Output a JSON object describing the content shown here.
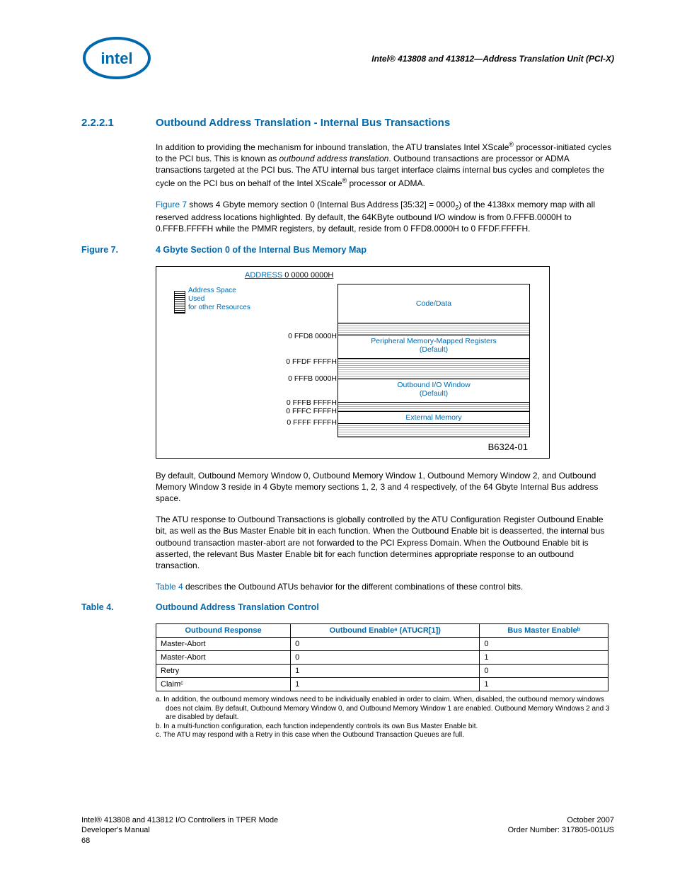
{
  "header": {
    "title_html": "Intel® 413808 and 413812—Address Translation Unit (PCI-X)"
  },
  "section": {
    "num": "2.2.2.1",
    "title": "Outbound Address Translation - Internal Bus Transactions"
  },
  "para1": "In addition to providing the mechanism for inbound translation, the ATU translates Intel XScale® processor-initiated cycles to the PCI bus. This is known as outbound address translation. Outbound transactions are processor or ADMA transactions targeted at the PCI bus. The ATU internal bus target interface claims internal bus cycles and completes the cycle on the PCI bus on behalf of the Intel XScale® processor or ADMA.",
  "para2_pre": "Figure 7",
  "para2_post": " shows 4 Gbyte memory section 0 (Internal Bus Address [35:32] = 0000",
  "para2_sub": "2",
  "para2_tail": ") of the 4138xx memory map with all reserved address locations highlighted. By default, the 64KByte outbound I/O window is from 0.FFFB.0000H to 0.FFFB.FFFFH while the PMMR registers, by default, reside from 0 FFD8.0000H to 0 FFDF.FFFFH.",
  "figure": {
    "label": "Figure 7.",
    "title": "4 Gbyte Section 0 of the Internal Bus Memory Map",
    "address_header": "ADDRESS",
    "top_addr": "0 0000 0000H",
    "hatch_label": "Address Space Used for other Resources",
    "bands": {
      "code_data": "Code/Data",
      "pmm": "Peripheral Memory-Mapped Registers (Default)",
      "oio": "Outbound I/O Window (Default)",
      "ext": "External Memory"
    },
    "addrs": {
      "a1": "0 FFD8 0000H",
      "a2": "0 FFDF FFFFH",
      "a3": "0 FFFB 0000H",
      "a4": "0 FFFB FFFFH",
      "a5": "0 FFFC FFFFH",
      "a6": "0 FFFF FFFFH"
    },
    "id": "B6324-01"
  },
  "para3": "By default, Outbound Memory Window 0, Outbound Memory Window 1, Outbound Memory Window 2, and Outbound Memory Window 3 reside in 4 Gbyte memory sections 1, 2, 3 and 4 respectively, of the 64 Gbyte Internal Bus address space.",
  "para4": "The ATU response to Outbound Transactions is globally controlled by the ATU Configuration Register Outbound Enable bit, as well as the Bus Master Enable bit in each function. When the Outbound Enable bit is deasserted, the internal bus outbound transaction master-abort are not forwarded to the PCI Express Domain. When the Outbound Enable bit is asserted, the relevant Bus Master Enable bit for each function determines appropriate response to an outbound transaction.",
  "para5_pre": "Table 4",
  "para5_post": " describes the Outbound ATUs behavior for the different combinations of these control bits.",
  "table": {
    "label": "Table 4.",
    "title": "Outbound Address Translation Control",
    "headers": {
      "c1": "Outbound Response",
      "c2": "Outbound Enableᵃ (ATUCR[1])",
      "c3": "Bus Master Enableᵇ"
    },
    "rows": [
      {
        "r": "Master-Abort",
        "oe": "0",
        "bm": "0"
      },
      {
        "r": "Master-Abort",
        "oe": "0",
        "bm": "1"
      },
      {
        "r": "Retry",
        "oe": "1",
        "bm": "0"
      },
      {
        "r": "Claimᶜ",
        "oe": "1",
        "bm": "1"
      }
    ]
  },
  "footnotes": {
    "a": "a.  In addition, the outbound memory windows need to be individually enabled in order to claim. When, disabled, the outbound memory windows does not claim. By default, Outbound Memory Window 0, and Outbound Memory Window 1 are enabled. Outbound Memory Windows 2 and 3 are disabled by default.",
    "b": "b.  In a multi-function configuration, each function independently controls its own Bus Master Enable bit.",
    "c": "c.  The ATU may respond with a Retry in this case when the Outbound Transaction Queues are full."
  },
  "footer": {
    "left1": "Intel® 413808 and 413812 I/O Controllers in TPER Mode",
    "left2": "Developer's Manual",
    "left3": "68",
    "right1": "October 2007",
    "right2": "Order Number: 317805-001US"
  }
}
